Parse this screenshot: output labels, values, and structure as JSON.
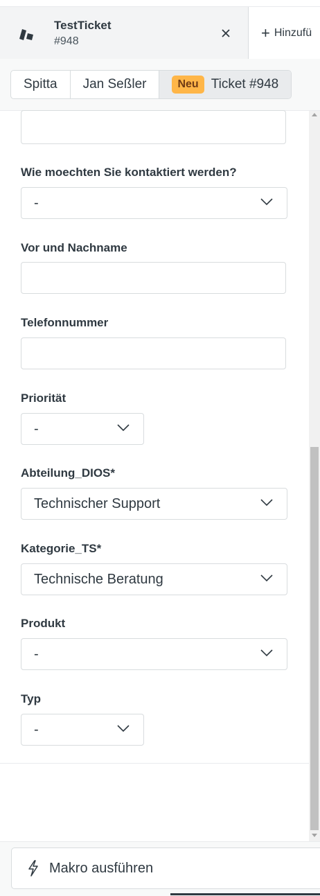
{
  "tab": {
    "title": "TestTicket",
    "subtitle": "#948",
    "close_icon": "close-icon",
    "add_label": "Hinzufü"
  },
  "breadcrumb": {
    "items": [
      "Spitta",
      "Jan Seßler"
    ],
    "current_badge": "Neu",
    "current_label": "Ticket #948"
  },
  "form": {
    "top_input_value": "",
    "contact": {
      "label": "Wie moechten Sie kontaktiert werden?",
      "value": "-"
    },
    "name": {
      "label": "Vor und Nachname",
      "value": ""
    },
    "phone": {
      "label": "Telefonnummer",
      "value": ""
    },
    "priority": {
      "label": "Priorität",
      "value": "-"
    },
    "department": {
      "label": "Abteilung_DIOS*",
      "value": "Technischer Support"
    },
    "category": {
      "label": "Kategorie_TS*",
      "value": "Technische Beratung"
    },
    "product": {
      "label": "Produkt",
      "value": "-"
    },
    "type": {
      "label": "Typ",
      "value": "-"
    }
  },
  "footer": {
    "macro_label": "Makro ausführen",
    "macro_icon": "lightning-icon"
  },
  "colors": {
    "badge_bg": "#ffb648",
    "text": "#2f3941",
    "border": "#d8dcde"
  }
}
